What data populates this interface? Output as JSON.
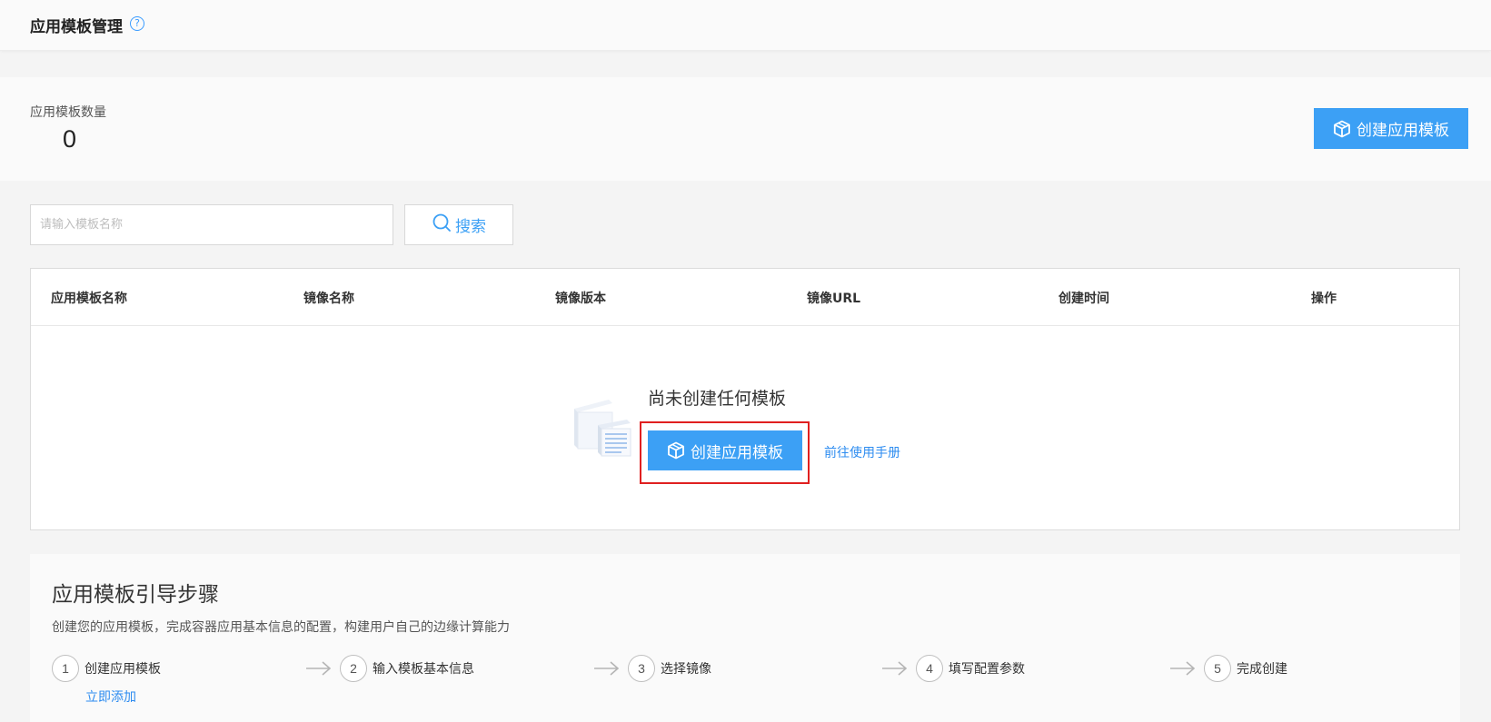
{
  "header": {
    "title": "应用模板管理",
    "help_icon": "question-circle-icon"
  },
  "stats": {
    "count_label": "应用模板数量",
    "count_value": "0"
  },
  "actions": {
    "create_label": "创建应用模板",
    "create_icon": "cube-icon"
  },
  "search": {
    "placeholder": "请输入模板名称",
    "value": "",
    "button_label": "搜索",
    "button_icon": "search-icon"
  },
  "table": {
    "columns": [
      "应用模板名称",
      "镜像名称",
      "镜像版本",
      "镜像URL",
      "创建时间",
      "操作"
    ],
    "rows": []
  },
  "empty_state": {
    "message": "尚未创建任何模板",
    "create_label": "创建应用模板",
    "manual_link": "前往使用手册",
    "illustration_icon": "empty-documents-icon"
  },
  "guide": {
    "title": "应用模板引导步骤",
    "description": "创建您的应用模板，完成容器应用基本信息的配置，构建用户自己的边缘计算能力",
    "steps": [
      {
        "num": "1",
        "label": "创建应用模板"
      },
      {
        "num": "2",
        "label": "输入模板基本信息"
      },
      {
        "num": "3",
        "label": "选择镜像"
      },
      {
        "num": "4",
        "label": "填写配置参数"
      },
      {
        "num": "5",
        "label": "完成创建"
      }
    ],
    "add_now_link": "立即添加"
  },
  "colors": {
    "primary": "#3ca0f5",
    "link": "#2d8cf0",
    "highlight": "#e02020"
  }
}
